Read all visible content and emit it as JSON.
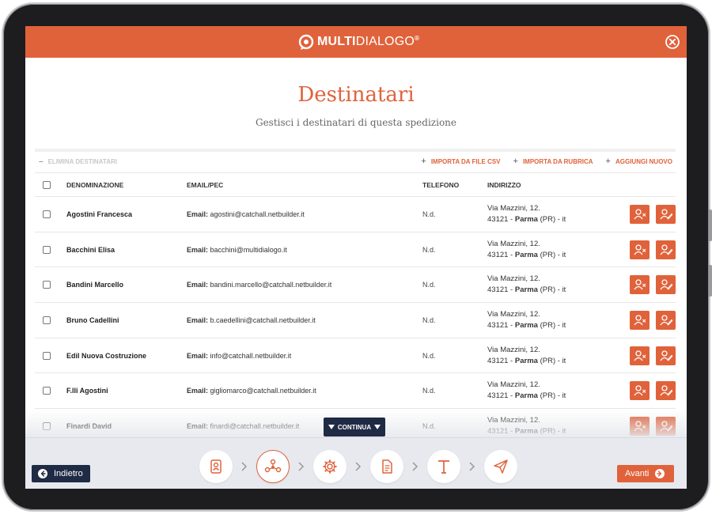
{
  "app": {
    "logo_bold": "MULTI",
    "logo_thin": "DIALOGO",
    "logo_reg": "®"
  },
  "page": {
    "title": "Destinatari",
    "subtitle": "Gestisci i destinatari di questa spedizione"
  },
  "toolbar": {
    "delete_label": "ELIMINA DESTINATARI",
    "import_csv_label": "IMPORTA DA FILE CSV",
    "import_book_label": "IMPORTA DA RUBRICA",
    "add_new_label": "AGGIUNGI NUOVO"
  },
  "table": {
    "headers": {
      "name": "DENOMINAZIONE",
      "email": "EMAIL/PEC",
      "phone": "TELEFONO",
      "address": "INDIRIZZO"
    },
    "email_prefix": "Email:",
    "rows": [
      {
        "name": "Agostini Francesca",
        "email": "agostini@catchall.netbuilder.it",
        "phone": "N.d.",
        "street": "Via Mazzini, 12.",
        "cap": "43121",
        "city": "Parma",
        "prov": "(PR)",
        "country": "it"
      },
      {
        "name": "Bacchini Elisa",
        "email": "bacchini@multidialogo.it",
        "phone": "N.d.",
        "street": "Via Mazzini, 12.",
        "cap": "43121",
        "city": "Parma",
        "prov": "(PR)",
        "country": "it"
      },
      {
        "name": "Bandini Marcello",
        "email": "bandini.marcello@catchall.netbuilder.it",
        "phone": "N.d.",
        "street": "Via Mazzini, 12.",
        "cap": "43121",
        "city": "Parma",
        "prov": "(PR)",
        "country": "it"
      },
      {
        "name": "Bruno Cadellini",
        "email": "b.caedellini@catchall.netbuilder.it",
        "phone": "N.d.",
        "street": "Via Mazzini, 12.",
        "cap": "43121",
        "city": "Parma",
        "prov": "(PR)",
        "country": "it"
      },
      {
        "name": "Edil Nuova Costruzione",
        "email": "info@catchall.netbuilder.it",
        "phone": "N.d.",
        "street": "Via Mazzini, 12.",
        "cap": "43121",
        "city": "Parma",
        "prov": "(PR)",
        "country": "it"
      },
      {
        "name": "F.lli Agostini",
        "email": "gigliomarco@catchall.netbuilder.it",
        "phone": "N.d.",
        "street": "Via Mazzini, 12.",
        "cap": "43121",
        "city": "Parma",
        "prov": "(PR)",
        "country": "it"
      },
      {
        "name": "Finardi David",
        "email": "finardi@catchall.netbuilder.it",
        "phone": "N.d.",
        "street": "Via Mazzini, 12.",
        "cap": "43121",
        "city": "Parma",
        "prov": "(PR)",
        "country": "it"
      }
    ]
  },
  "continua_label": "CONTINUA",
  "footer": {
    "back_label": "Indietro",
    "next_label": "Avanti"
  },
  "steps": [
    {
      "icon": "address-book-icon"
    },
    {
      "icon": "network-icon",
      "active": true
    },
    {
      "icon": "gear-icon"
    },
    {
      "icon": "document-icon"
    },
    {
      "icon": "text-icon"
    },
    {
      "icon": "paper-plane-icon"
    }
  ],
  "colors": {
    "accent": "#e0623b",
    "navy": "#1f2a44"
  }
}
